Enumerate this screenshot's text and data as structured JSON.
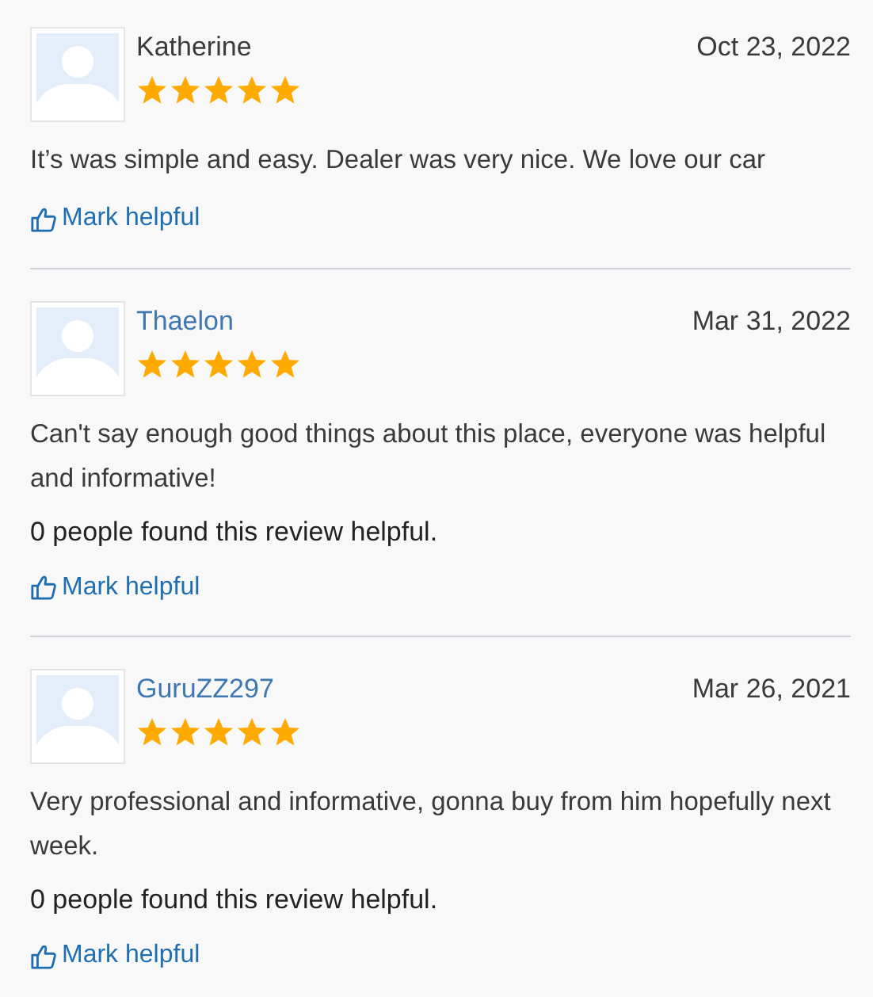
{
  "reviews": [
    {
      "name": "Katherine",
      "linked": false,
      "stars": 5,
      "date": "Oct 23, 2022",
      "text": "It’s was simple and easy. Dealer was very nice. We love our car",
      "action": "Mark helpful"
    },
    {
      "name": "Thaelon",
      "linked": true,
      "stars": 5,
      "date": "Mar 31, 2022",
      "text": "Can't say enough good things about this place, everyone was helpful and informative!",
      "helpful_count": "0 people found this review helpful.",
      "action": "Mark helpful"
    },
    {
      "name": "GuruZZ297",
      "linked": true,
      "stars": 5,
      "date": "Mar 26, 2021",
      "text": "Very professional and informative, gonna buy from him hopefully next week.",
      "helpful_count": "0 people found this review helpful.",
      "action": "Mark helpful"
    }
  ]
}
